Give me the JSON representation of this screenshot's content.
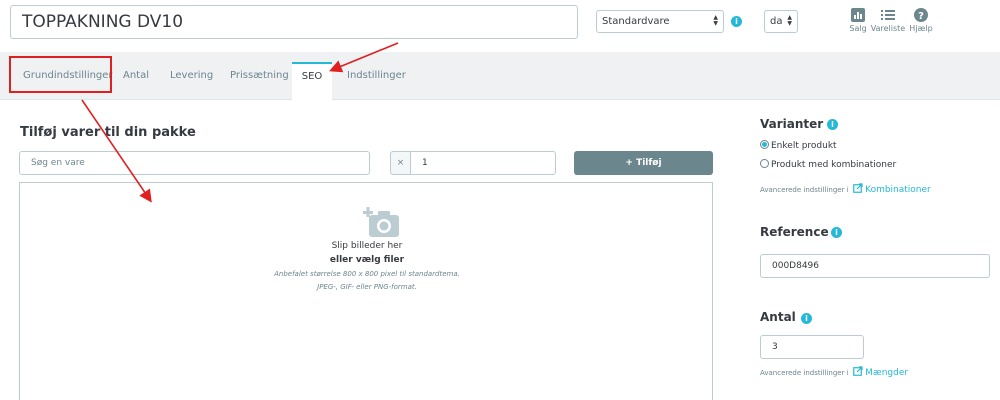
{
  "header": {
    "product_name": "TOPPAKNING DV10",
    "product_type": "Standardvare",
    "language": "da",
    "links": [
      {
        "label": "Salg",
        "icon": "bar-chart-icon"
      },
      {
        "label": "Vareliste",
        "icon": "list-icon"
      },
      {
        "label": "Hjælp",
        "icon": "help-icon"
      }
    ]
  },
  "tabs": [
    {
      "label": "Grundindstillinger",
      "active": false
    },
    {
      "label": "Antal",
      "active": false
    },
    {
      "label": "Levering",
      "active": false
    },
    {
      "label": "Prissætning",
      "active": false
    },
    {
      "label": "SEO",
      "active": true
    },
    {
      "label": "Indstillinger",
      "active": false
    }
  ],
  "pack": {
    "title": "Tilføj varer til din pakke",
    "search_placeholder": "Søg en vare",
    "qty_prefix": "×",
    "qty_value": "1",
    "add_label": "+ Tilføj"
  },
  "dropzone": {
    "line1": "Slip billeder her",
    "line2": "eller vælg filer",
    "hint1": "Anbefalet størrelse 800 x 800 pixel til standardtema.",
    "hint2": "JPEG-, GIF- eller PNG-format."
  },
  "variants": {
    "title": "Varianter",
    "options": [
      {
        "label": "Enkelt produkt",
        "checked": true
      },
      {
        "label": "Produkt med kombinationer",
        "checked": false
      }
    ],
    "advanced_label": "Avancerede indstillinger i",
    "advanced_link": "Kombinationer"
  },
  "reference": {
    "title": "Reference",
    "value": "000D8496"
  },
  "quantity": {
    "title": "Antal",
    "value": "3",
    "advanced_label": "Avancerede indstillinger i",
    "advanced_link": "Mængder"
  },
  "colors": {
    "accent": "#25b9d7",
    "annotation": "#e02020",
    "button": "#6c868e"
  }
}
